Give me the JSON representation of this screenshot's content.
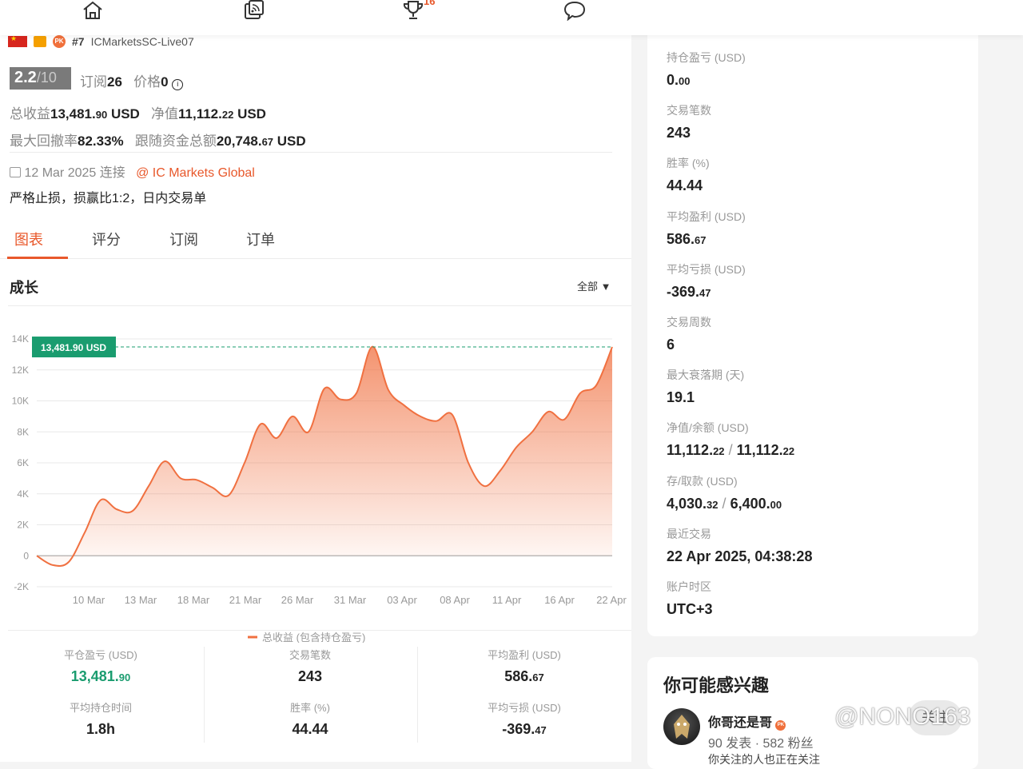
{
  "nav": {
    "trophy_badge": "16"
  },
  "profile": {
    "rank": "#7",
    "account": "ICMarketsSC-Live07",
    "score": "2.2",
    "score_den": "/10",
    "subscribe_label": "订阅",
    "subscribe_count": "26",
    "price_label": "价格",
    "price_value": "0",
    "total_profit_label": "总收益",
    "total_profit_main": "13,481.",
    "total_profit_dec": "90",
    "total_profit_cur": "USD",
    "equity_label": "净值",
    "equity_main": "11,112.",
    "equity_dec": "22",
    "equity_cur": "USD",
    "drawdown_label": "最大回撤率",
    "drawdown_value": "82.33%",
    "follow_funds_label": "跟随资金总额",
    "follow_funds_main": "20,748.",
    "follow_funds_dec": "67",
    "follow_funds_cur": "USD",
    "connect_date": "12 Mar 2025 连接",
    "broker": "@ IC Markets Global",
    "description": "严格止损，损赢比1:2，日内交易单"
  },
  "tabs": [
    "图表",
    "评分",
    "订阅",
    "订单"
  ],
  "growth": {
    "title": "成长",
    "filter": "全部"
  },
  "chart_data": {
    "type": "area",
    "x": [
      "10 Mar",
      "13 Mar",
      "18 Mar",
      "21 Mar",
      "26 Mar",
      "31 Mar",
      "03 Apr",
      "08 Apr",
      "11 Apr",
      "16 Apr",
      "22 Apr"
    ],
    "y_ticks": [
      "14K",
      "12K",
      "10K",
      "8K",
      "6K",
      "4K",
      "2K",
      "0",
      "-2K"
    ],
    "ylim": [
      -2000,
      14000
    ],
    "series": [
      {
        "name": "总收益 (包含持仓盈亏)",
        "color": "#f07040",
        "values": [
          0,
          -600,
          -400,
          1500,
          3600,
          3000,
          2900,
          4500,
          6100,
          5000,
          4900,
          4400,
          3900,
          6000,
          8500,
          7600,
          9000,
          8000,
          10800,
          10100,
          10500,
          13500,
          10700,
          9700,
          9000,
          8700,
          9100,
          6000,
          4500,
          5500,
          7000,
          8000,
          9300,
          8800,
          10500,
          11000,
          13481.9
        ]
      }
    ],
    "current_label": "13,481.90 USD",
    "current_value": 13481.9,
    "grid": true
  },
  "summary": {
    "closed_pl_label": "平仓盈亏 (USD)",
    "closed_pl_main": "13,481.",
    "closed_pl_dec": "90",
    "avg_hold_label": "平均持仓时间",
    "avg_hold": "1.8h",
    "trades_label": "交易笔数",
    "trades": "243",
    "winrate_label": "胜率 (%)",
    "winrate": "44.44",
    "avg_profit_label": "平均盈利 (USD)",
    "avg_profit_main": "586.",
    "avg_profit_dec": "67",
    "avg_loss_label": "平均亏损 (USD)",
    "avg_loss_main": "-369.",
    "avg_loss_dec": "47"
  },
  "right": {
    "items": [
      {
        "label": "持仓盈亏 (USD)",
        "main": "0.",
        "dec": "00"
      },
      {
        "label": "交易笔数",
        "main": "243",
        "dec": ""
      },
      {
        "label": "胜率 (%)",
        "main": "44.44",
        "dec": ""
      },
      {
        "label": "平均盈利 (USD)",
        "main": "586.",
        "dec": "67"
      },
      {
        "label": "平均亏损 (USD)",
        "main": "-369.",
        "dec": "47"
      },
      {
        "label": "交易周数",
        "main": "6",
        "dec": ""
      },
      {
        "label": "最大衰落期 (天)",
        "main": "19.1",
        "dec": ""
      },
      {
        "label": "净值/余额 (USD)",
        "main": "11,112.",
        "dec": "22",
        "main2": "11,112.",
        "dec2": "22"
      },
      {
        "label": "存/取款 (USD)",
        "main": "4,030.",
        "dec": "32",
        "main2": "6,400.",
        "dec2": "00"
      },
      {
        "label": "最近交易",
        "main": "22 Apr 2025, 04:38:28",
        "dec": ""
      },
      {
        "label": "账户时区",
        "main": "UTC+3",
        "dec": ""
      }
    ]
  },
  "interest": {
    "title": "你可能感兴趣",
    "user_name": "你哥还是哥",
    "posts": "90 发表",
    "fans": "582 粉丝",
    "follow_label": "关注",
    "cut_text": "你关注的人也正在关注"
  },
  "watermark": "@NONO163"
}
